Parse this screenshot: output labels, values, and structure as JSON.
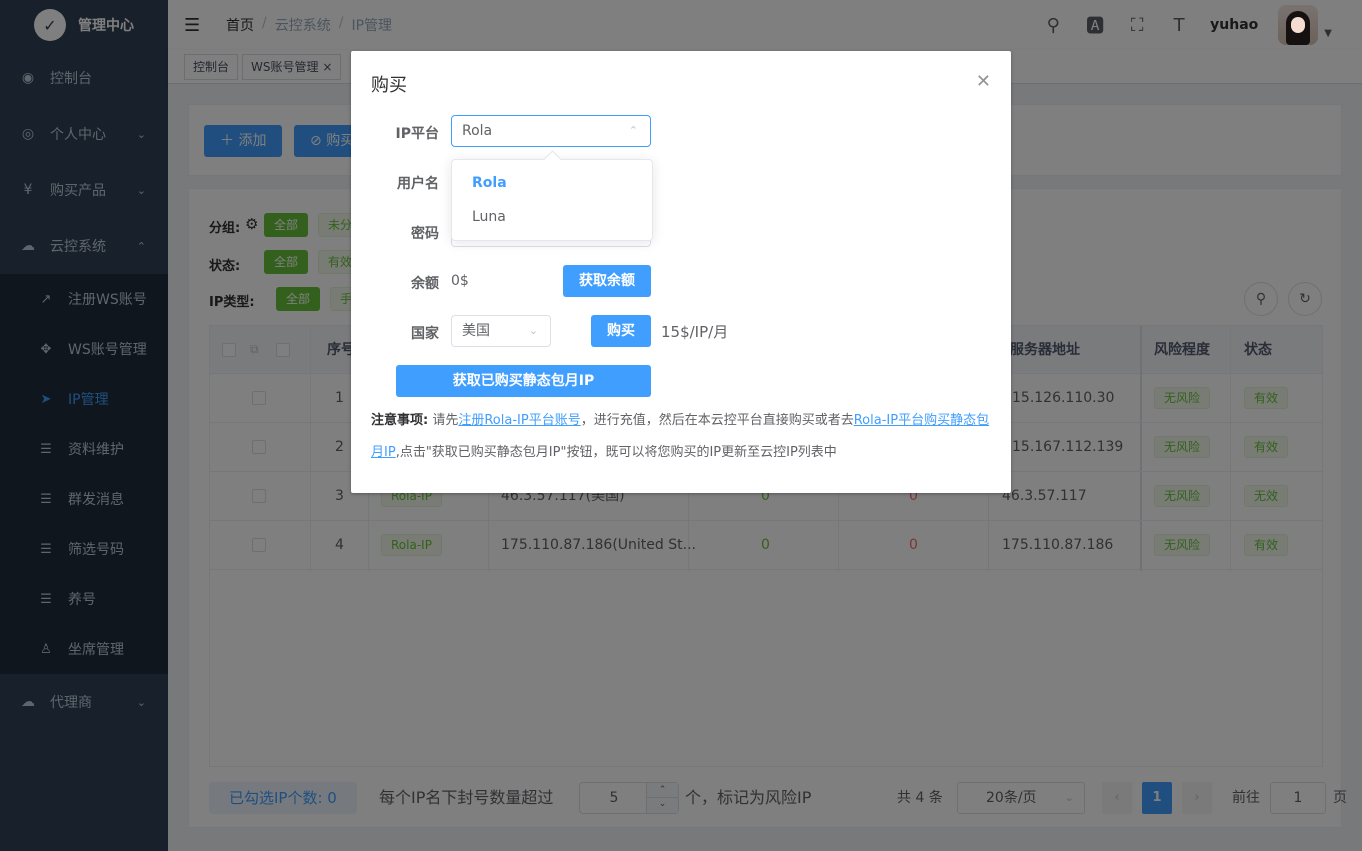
{
  "app": {
    "title": "管理中心"
  },
  "sidebar": {
    "items": [
      {
        "label": "控制台",
        "icon": "dashboard-icon"
      },
      {
        "label": "个人中心",
        "icon": "user-center-icon"
      },
      {
        "label": "购买产品",
        "icon": "yen-icon"
      },
      {
        "label": "云控系统",
        "icon": "cloud-icon"
      }
    ],
    "submenu": [
      {
        "label": "注册WS账号"
      },
      {
        "label": "WS账号管理"
      },
      {
        "label": "IP管理"
      },
      {
        "label": "资料维护"
      },
      {
        "label": "群发消息"
      },
      {
        "label": "筛选号码"
      },
      {
        "label": "养号"
      },
      {
        "label": "坐席管理"
      }
    ],
    "bottom": {
      "label": "代理商"
    }
  },
  "header": {
    "breadcrumb": [
      "首页",
      "云控系统",
      "IP管理"
    ],
    "username": "yuhao"
  },
  "tags": [
    "控制台",
    "WS账号管理"
  ],
  "toolbar": {
    "add_label": "添加",
    "buy_label": "购买"
  },
  "filters": {
    "group_label": "分组:",
    "status_label": "状态:",
    "iptype_label": "IP类型:",
    "all": "全部",
    "ungrouped": "未分",
    "valid": "有效",
    "manual": "手"
  },
  "table": {
    "headers": [
      "序号",
      "服务器地址",
      "风险程度",
      "状态"
    ],
    "rows": [
      {
        "index": "1",
        "server": "15.126.110.30",
        "risk": "无风险",
        "status": "有效"
      },
      {
        "index": "2",
        "server": "15.167.112.139",
        "risk": "无风险",
        "status": "有效"
      },
      {
        "index": "3",
        "type": "Rola-IP",
        "ip": "46.3.57.117(美国)",
        "a": "0",
        "b": "0",
        "server": "46.3.57.117",
        "risk": "无风险",
        "status": "无效"
      },
      {
        "index": "4",
        "type": "Rola-IP",
        "ip": "175.110.87.186(United St...",
        "a": "0",
        "b": "0",
        "server": "175.110.87.186",
        "risk": "无风险",
        "status": "有效"
      }
    ]
  },
  "footer": {
    "selected_label": "已勾选IP个数:  0",
    "threshold_prefix": "每个IP名下封号数量超过",
    "threshold_value": "5",
    "threshold_suffix": "个，标记为风险IP",
    "total": "共 4 条",
    "page_size": "20条/页",
    "current_page": "1",
    "goto_prefix": "前往",
    "goto_value": "1",
    "goto_suffix": "页"
  },
  "dialog": {
    "title": "购买",
    "platform_label": "IP平台",
    "platform_value": "Rola",
    "username_label": "用户名",
    "password_label": "密码",
    "balance_label": "余额",
    "balance_value": "0$",
    "get_balance_label": "获取余额",
    "country_label": "国家",
    "country_value": "美国",
    "buy_label": "购买",
    "price": "15$/IP/月",
    "fetch_label": "获取已购买静态包月IP",
    "notice_title": "注意事项:",
    "notice_1": "请先",
    "notice_link1": "注册Rola-IP平台账号",
    "notice_2": "，进行充值，然后在本云控平台直接购买或者去",
    "notice_link2": "Rola-IP平台购买静态包月IP",
    "notice_3": ",点击\"获取已购买静态包月IP\"按钮，既可以将您购买的IP更新至云控IP列表中"
  },
  "dropdown": {
    "options": [
      "Rola",
      "Luna"
    ]
  },
  "colors": {
    "primary": "#409eff",
    "success": "#67c23a",
    "danger": "#f56c6c",
    "sidebar": "#304156"
  }
}
